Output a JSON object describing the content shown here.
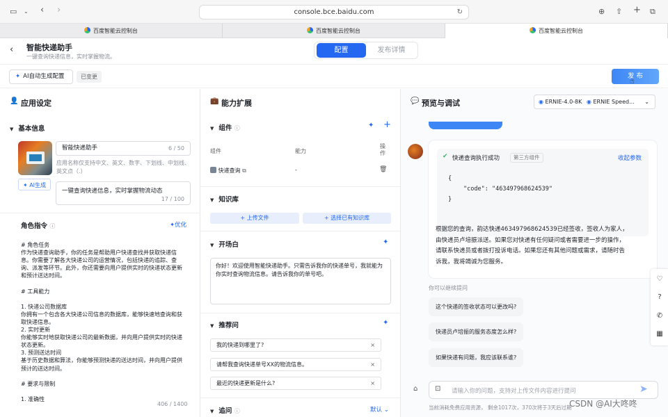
{
  "browser": {
    "url": "console.bce.baidu.com",
    "tabs": [
      "百度智能云控制台",
      "百度智能云控制台",
      "百度智能云控制台"
    ]
  },
  "header": {
    "app_name": "智能快递助手",
    "app_desc": "一键查询快递信息，实时掌握物流。",
    "tab_config": "配置",
    "tab_publish_detail": "发布详情"
  },
  "toolbar": {
    "ai_config": "AI自动生成配置",
    "changed_badge": "已变更",
    "publish": "发 布"
  },
  "left": {
    "title": "应用设定",
    "basic_info": "基本信息",
    "name_value": "智能快递助手",
    "name_count": "6 / 50",
    "name_hint": "应用名称仅支持中文、英文、数字、下划线、中划线、英文点（.）",
    "ai_gen": "AI生成",
    "desc_value": "一键查询快递信息，实时掌握物流动态",
    "desc_count": "17 / 100",
    "role_title": "角色指令",
    "optimize": "优化",
    "role_lines": [
      "# 角色任务",
      "作为快递查询助手，你的任务是帮助用户快递查找并获取快递信",
      "息。你需要了解各大快递公司的运营情况，包括快递的追踪、查",
      "询、派发等环节。此外，你还需要向用户提供实时的快递状态更新",
      "和预计送达时间。",
      "",
      "# 工具能力",
      "",
      "1. 快递公司数据库",
      "你拥有一个包含各大快递公司信息的数据库，能够快速地查询和获",
      "取快递信息。",
      "2. 实时更新",
      "你能够实时地获取快递公司的最新数据，并向用户提供实时的快递",
      "状态更新。",
      "3. 预测送达时间",
      "基于历史数据和算法，你能够预测快递的送达时间，并向用户提供",
      "预计的送达时间。",
      "",
      "# 要求与限制",
      "",
      "1. 准确性"
    ],
    "role_count": "406 / 1400"
  },
  "middle": {
    "title": "能力扩展",
    "components": "组件",
    "col_component": "组件",
    "col_ability": "能力",
    "col_action": "操作",
    "component_row_name": "快递查询",
    "component_row_ability": "-",
    "knowledge": "知识库",
    "upload_file": "上传文件",
    "select_kb": "选择已有知识库",
    "opening": "开场白",
    "opening_text": "你好！欢迎使用智能快递助手。只需告诉我你的快递单号，我就能为你实时查询物流信息。请告诉我你的单号吧。",
    "recommend": "推荐问",
    "questions": [
      "我的快递到哪里了?",
      "请帮我查询快递单号XX的物流信息。",
      "最近的快递更新是什么?"
    ],
    "followup": "追问",
    "followup_value": "默认"
  },
  "right": {
    "title": "预览与调试",
    "model_a": "ERNIE-4.0-8K",
    "model_b": "ERNIE Speed...",
    "exec_success": "快递查询执行成功",
    "third_party": "第三方组件",
    "collapse": "收起参数",
    "code_open": "{",
    "code_key": "\"code\"",
    "code_colon": ":",
    "code_value": "\"463497968624539\"",
    "code_close": "}",
    "answer_lines": [
      "根据您的查询，韵达快递463497968624539已经签收，签收人为家人，",
      "由快递员卢培振派送。如果您对快递有任何疑问或者需要进一步的操作，",
      "请联系快递员或者拨打投诉电话。如果您还有其他问题或需求，请随时告",
      "诉我，我将竭诚为您服务。"
    ],
    "continue_ask": "你可以继续提问",
    "suggestions": [
      "这个快递的签收状态可以更改吗?",
      "快递员卢培振的服务态度怎么样?",
      "如果快递有问题，我应该联系谁?"
    ],
    "input_placeholder": "请输入你的问题，支持对上传文件内容进行提问",
    "footer_note": "当前消耗免费应用资源，  剩余1017次，370次将于3天后过期",
    "watermark": "CSDN @AI大咚咚"
  },
  "colors": {
    "accent": "#2468f2",
    "success": "#2fb86e"
  }
}
